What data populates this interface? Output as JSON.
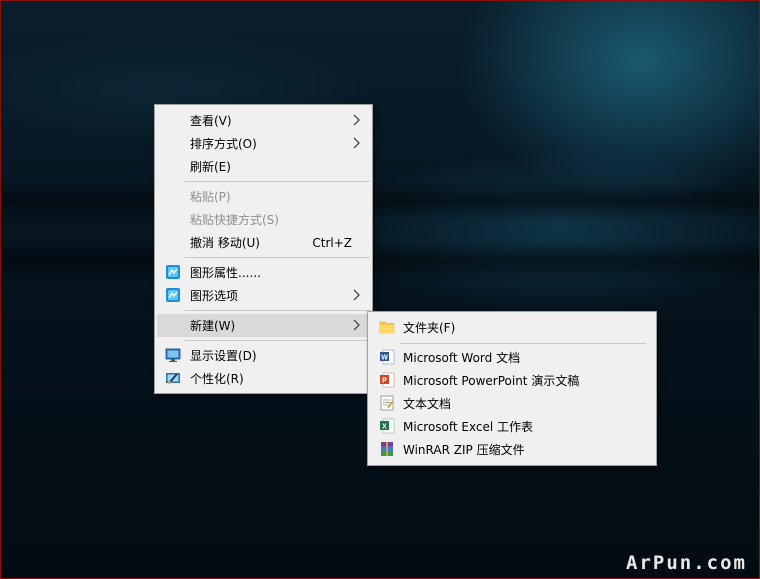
{
  "context_menu": {
    "items": [
      {
        "label": "查看(V)",
        "has_submenu": true,
        "enabled": true
      },
      {
        "label": "排序方式(O)",
        "has_submenu": true,
        "enabled": true
      },
      {
        "label": "刷新(E)",
        "enabled": true
      },
      {
        "label": "粘贴(P)",
        "enabled": false
      },
      {
        "label": "粘贴快捷方式(S)",
        "enabled": false
      },
      {
        "label": "撤消 移动(U)",
        "shortcut": "Ctrl+Z",
        "enabled": true
      },
      {
        "label": "图形属性......",
        "icon": "graphics-icon",
        "enabled": true
      },
      {
        "label": "图形选项",
        "icon": "graphics-icon",
        "has_submenu": true,
        "enabled": true
      },
      {
        "label": "新建(W)",
        "has_submenu": true,
        "enabled": true,
        "highlighted": true
      },
      {
        "label": "显示设置(D)",
        "icon": "display-icon",
        "enabled": true
      },
      {
        "label": "个性化(R)",
        "icon": "personalize-icon",
        "enabled": true
      }
    ]
  },
  "new_submenu": {
    "items": [
      {
        "label": "文件夹(F)",
        "icon": "folder-icon"
      },
      {
        "label": "Microsoft Word 文档",
        "icon": "word-icon"
      },
      {
        "label": "Microsoft PowerPoint 演示文稿",
        "icon": "powerpoint-icon"
      },
      {
        "label": "文本文档",
        "icon": "text-document-icon"
      },
      {
        "label": "Microsoft Excel 工作表",
        "icon": "excel-icon"
      },
      {
        "label": "WinRAR ZIP 压缩文件",
        "icon": "winrar-icon"
      }
    ]
  },
  "watermark": "ArPun.com",
  "colors": {
    "menu_bg": "#f0f0f0",
    "highlight": "#d9d9d9",
    "disabled_text": "#8f8f8f"
  }
}
